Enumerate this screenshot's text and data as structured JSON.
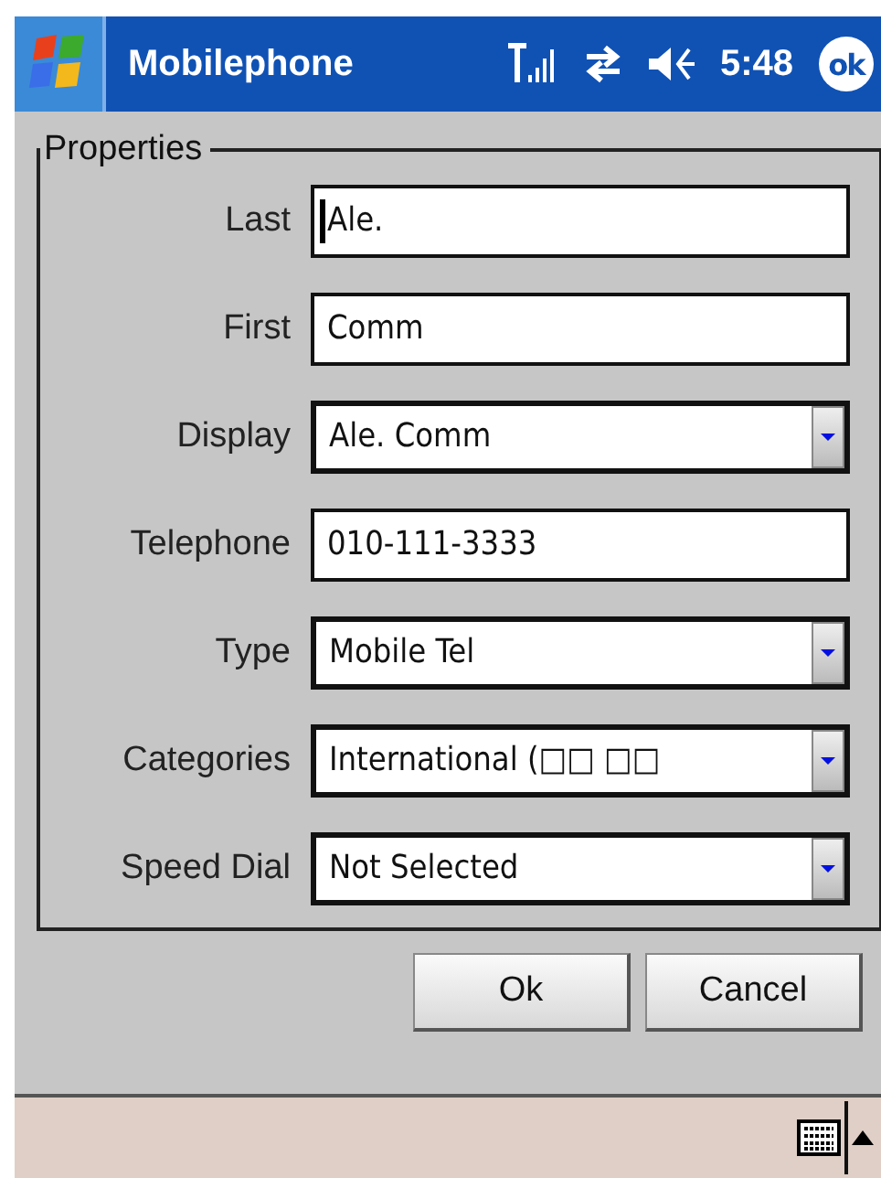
{
  "title_bar": {
    "title": "Mobilephone",
    "time": "5:48",
    "ok": "ok"
  },
  "group": {
    "title": "Properties",
    "fields": [
      {
        "label": "Last",
        "kind": "text",
        "value": "Ale.",
        "focused": true
      },
      {
        "label": "First",
        "kind": "text",
        "value": "Comm",
        "focused": false
      },
      {
        "label": "Display",
        "kind": "dropdown",
        "value": "Ale. Comm",
        "focused": false
      },
      {
        "label": "Telephone",
        "kind": "text",
        "value": "010-111-3333",
        "focused": false
      },
      {
        "label": "Type",
        "kind": "dropdown",
        "value": "Mobile Tel",
        "focused": false
      },
      {
        "label": "Categories",
        "kind": "dropdown",
        "value": "International (□□ □□",
        "focused": false
      },
      {
        "label": "Speed Dial",
        "kind": "dropdown",
        "value": "Not Selected",
        "focused": false
      }
    ]
  },
  "buttons": [
    "Ok",
    "Cancel"
  ]
}
